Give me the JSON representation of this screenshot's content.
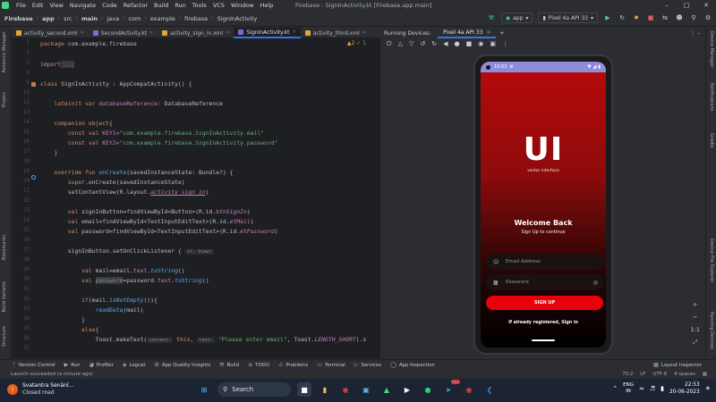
{
  "menu": [
    "File",
    "Edit",
    "View",
    "Navigate",
    "Code",
    "Refactor",
    "Build",
    "Run",
    "Tools",
    "VCS",
    "Window",
    "Help"
  ],
  "window_title": "Firebase - SignInActivity.kt [Firebase.app.main]",
  "breadcrumb": [
    "Firebase",
    "app",
    "src",
    "main",
    "java",
    "com",
    "example",
    "firebase",
    "SignInActivity"
  ],
  "run_config": "app",
  "device_select": "Pixel 4a API 33",
  "editor_tabs": [
    {
      "label": "activity_second.xml",
      "color": "#e8a33d"
    },
    {
      "label": "SecondActivity.kt",
      "color": "#8a63d2"
    },
    {
      "label": "activity_sign_in.xml",
      "color": "#e8a33d"
    },
    {
      "label": "SignInActivity.kt",
      "color": "#8a63d2"
    },
    {
      "label": "activity_third.xml",
      "color": "#e8a33d"
    }
  ],
  "inspection": {
    "warnings": "▲2",
    "weak": "✓ 1"
  },
  "line_numbers": [
    "1",
    "2",
    "3",
    "4",
    "5",
    "11",
    "12",
    "13",
    "14",
    "15",
    "16",
    "17",
    "18",
    "19",
    "20",
    "21",
    "22",
    "23",
    "24",
    "25",
    "26",
    "27",
    "28",
    "29",
    "30",
    "31",
    "32",
    "33",
    "34",
    "35",
    "36",
    "37",
    "38",
    "39"
  ],
  "code": {
    "package_kw": "package",
    "package_name": " com.example.firebase",
    "import_kw": "import",
    "import_rest": " ...",
    "l13_kw": "class",
    "l13_rest": " SignInActivity : AppCompatActivity() {",
    "l15_kw": "lateinit var",
    "l15_prop": "databaseReference",
    "l15_rest": ": DatabaseReference",
    "l17_kw": "companion object",
    "l17_rest": "{",
    "l18_kw": "const val",
    "l18_name": " KEY1=",
    "l18_str": "\"com.example.firebase.SignInActivity.mail\"",
    "l19_kw": "const val",
    "l19_name": " KEY2=",
    "l19_str": "\"com.example.firebase.SignInActivity.password\"",
    "l20": "}",
    "l22_kw": "override fun",
    "l22_fn": " onCreate",
    "l22_rest": "(savedInstanceState: Bundle?) {",
    "l23_kw": "super",
    "l23_rest": ".onCreate(savedInstanceState)",
    "l24_rest": "setContentView(R.layout.",
    "l24_it": "activity_sign_in",
    "l24_end": ")",
    "l26_kw": "val",
    "l26_rest": " signInButton=findViewById<Button>(R.id.",
    "l26_it": "btnSignIn",
    "l26_end": ")",
    "l27_kw": "val",
    "l27_rest": " email=findViewById<TextInputEditText>(R.id.",
    "l27_it": "etMail",
    "l27_end": ")",
    "l28_kw": "val",
    "l28_rest": " password=findViewById<TextInputEditText>(R.id.",
    "l28_it": "etPassword",
    "l28_end": ")",
    "l30_rest": "signInButton.setOnClickListener {",
    "l30_hint": "it: View!",
    "l32_kw": "val",
    "l32_rest": " mail=email.",
    "l32_prop": "text",
    "l32_dot": ".",
    "l32_it": "toString",
    "l32_end": "()",
    "l33_kw": "val",
    "l33_hl": "password",
    "l33_rest": "=password.",
    "l33_prop": "text",
    "l33_dot": ".",
    "l33_it": "toString",
    "l33_end": "()",
    "l35_kw": "if",
    "l35_rest": "(mail.",
    "l35_it": "isNotEmpty",
    "l35_end": "()){",
    "l36_fn": "readData",
    "l36_rest": "(mail)",
    "l37": "}",
    "l38_kw": "else",
    "l38_rest": "{",
    "l39_rest": "Toast.makeText(",
    "l39_hint1": "context:",
    "l39_kw": " this",
    "l39_c": ",",
    "l39_hint2": "text:",
    "l39_str": " \"Please enter email\"",
    "l39_rest2": ", Toast.",
    "l39_it": "LENGTH_SHORT",
    "l39_end": ").s"
  },
  "left_strip": [
    "Resource Manager",
    "Project",
    "Bookmarks",
    "Build Variants",
    "Structure"
  ],
  "right_strip": [
    "Device Manager",
    "Notifications",
    "Gradle",
    "Device File Explorer",
    "Running Devices"
  ],
  "running_devices": {
    "title": "Running Devices:",
    "tab": "Pixel 4a API 33"
  },
  "phone": {
    "time": "10:53",
    "logo": "UI",
    "logo_sub": "vector interface",
    "welcome": "Welcome Back",
    "welcome_sub": "Sign Up to continue",
    "email_placeholder": "Email Address",
    "password_placeholder": "Password",
    "signup_label": "SIGN UP",
    "signin_link": "If already registered, Sign in"
  },
  "zoom": [
    "+",
    "−",
    "1:1",
    "⤢"
  ],
  "bottom_tools": [
    "Version Control",
    "Run",
    "Profiler",
    "Logcat",
    "App Quality Insights",
    "Build",
    "TODO",
    "Problems",
    "Terminal",
    "Services",
    "App Inspection"
  ],
  "layout_inspector": "Layout Inspector",
  "status_message": "Launch succeeded (a minute ago)",
  "status_right": [
    "70:2",
    "LF",
    "UTF-8",
    "4 spaces"
  ],
  "taskbar": {
    "weather_title": "Svatantra Senānī...",
    "weather_sub": "Closed road",
    "search": "Search",
    "lang1": "ENG",
    "lang2": "IN",
    "time": "22:53",
    "date": "20-06-2023",
    "badge": "99+"
  }
}
